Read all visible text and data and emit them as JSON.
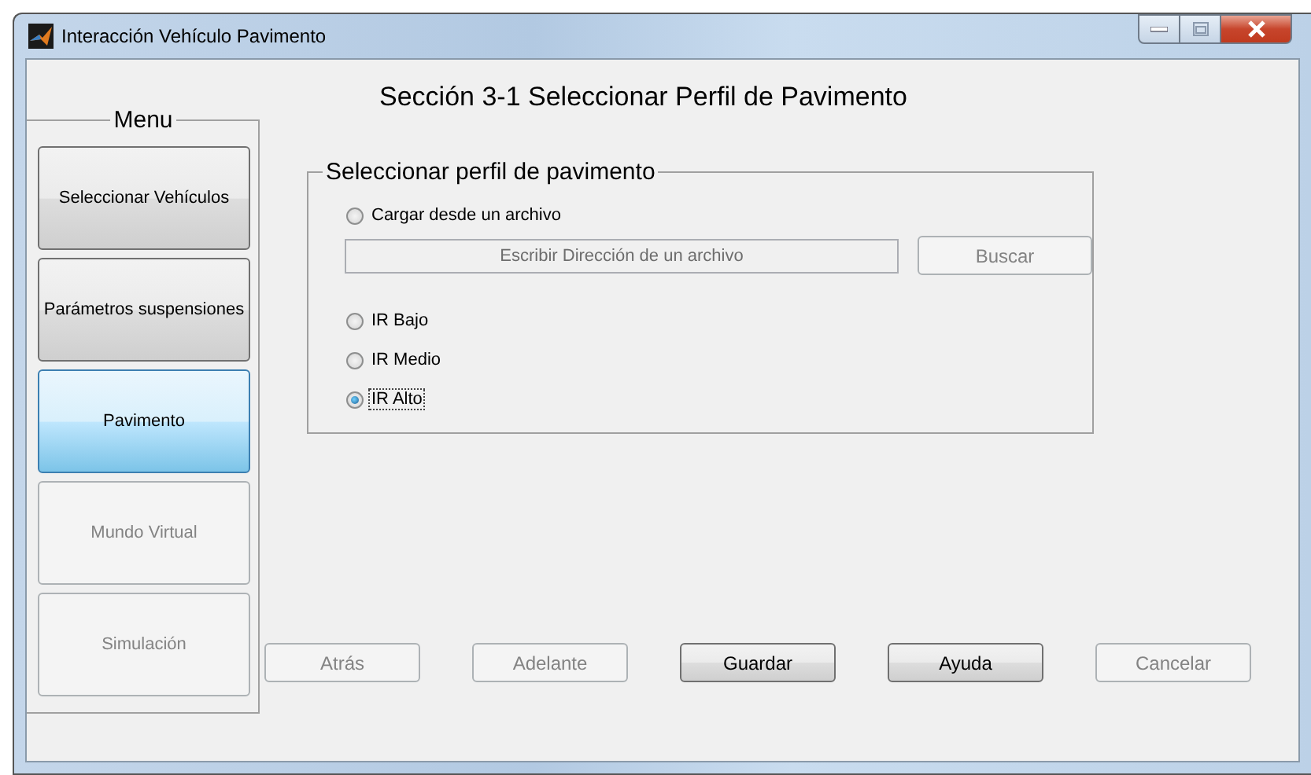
{
  "window": {
    "title": "Interacción Vehículo Pavimento"
  },
  "menu": {
    "label": "Menu",
    "items": [
      {
        "label": "Seleccionar Vehículos",
        "selected": false,
        "disabled": false
      },
      {
        "label": "Parámetros suspensiones",
        "selected": false,
        "disabled": false
      },
      {
        "label": "Pavimento",
        "selected": true,
        "disabled": false
      },
      {
        "label": "Mundo Virtual",
        "selected": false,
        "disabled": true
      },
      {
        "label": "Simulación",
        "selected": false,
        "disabled": true
      }
    ]
  },
  "heading": "Sección 3-1 Seleccionar Perfil de Pavimento",
  "group": {
    "label": "Seleccionar perfil de pavimento",
    "options": [
      {
        "label": "Cargar desde un archivo",
        "selected": false
      },
      {
        "label": "IR Bajo",
        "selected": false
      },
      {
        "label": "IR Medio",
        "selected": false
      },
      {
        "label": "IR Alto",
        "selected": true
      }
    ],
    "path_field": {
      "value": "Escribir Dirección de un archivo",
      "disabled": true
    },
    "browse_button": {
      "label": "Buscar",
      "disabled": true
    }
  },
  "buttons": [
    {
      "label": "Atrás",
      "disabled": true
    },
    {
      "label": "Adelante",
      "disabled": true
    },
    {
      "label": "Guardar",
      "disabled": false
    },
    {
      "label": "Ayuda",
      "disabled": false
    },
    {
      "label": "Cancelar",
      "disabled": true
    }
  ]
}
